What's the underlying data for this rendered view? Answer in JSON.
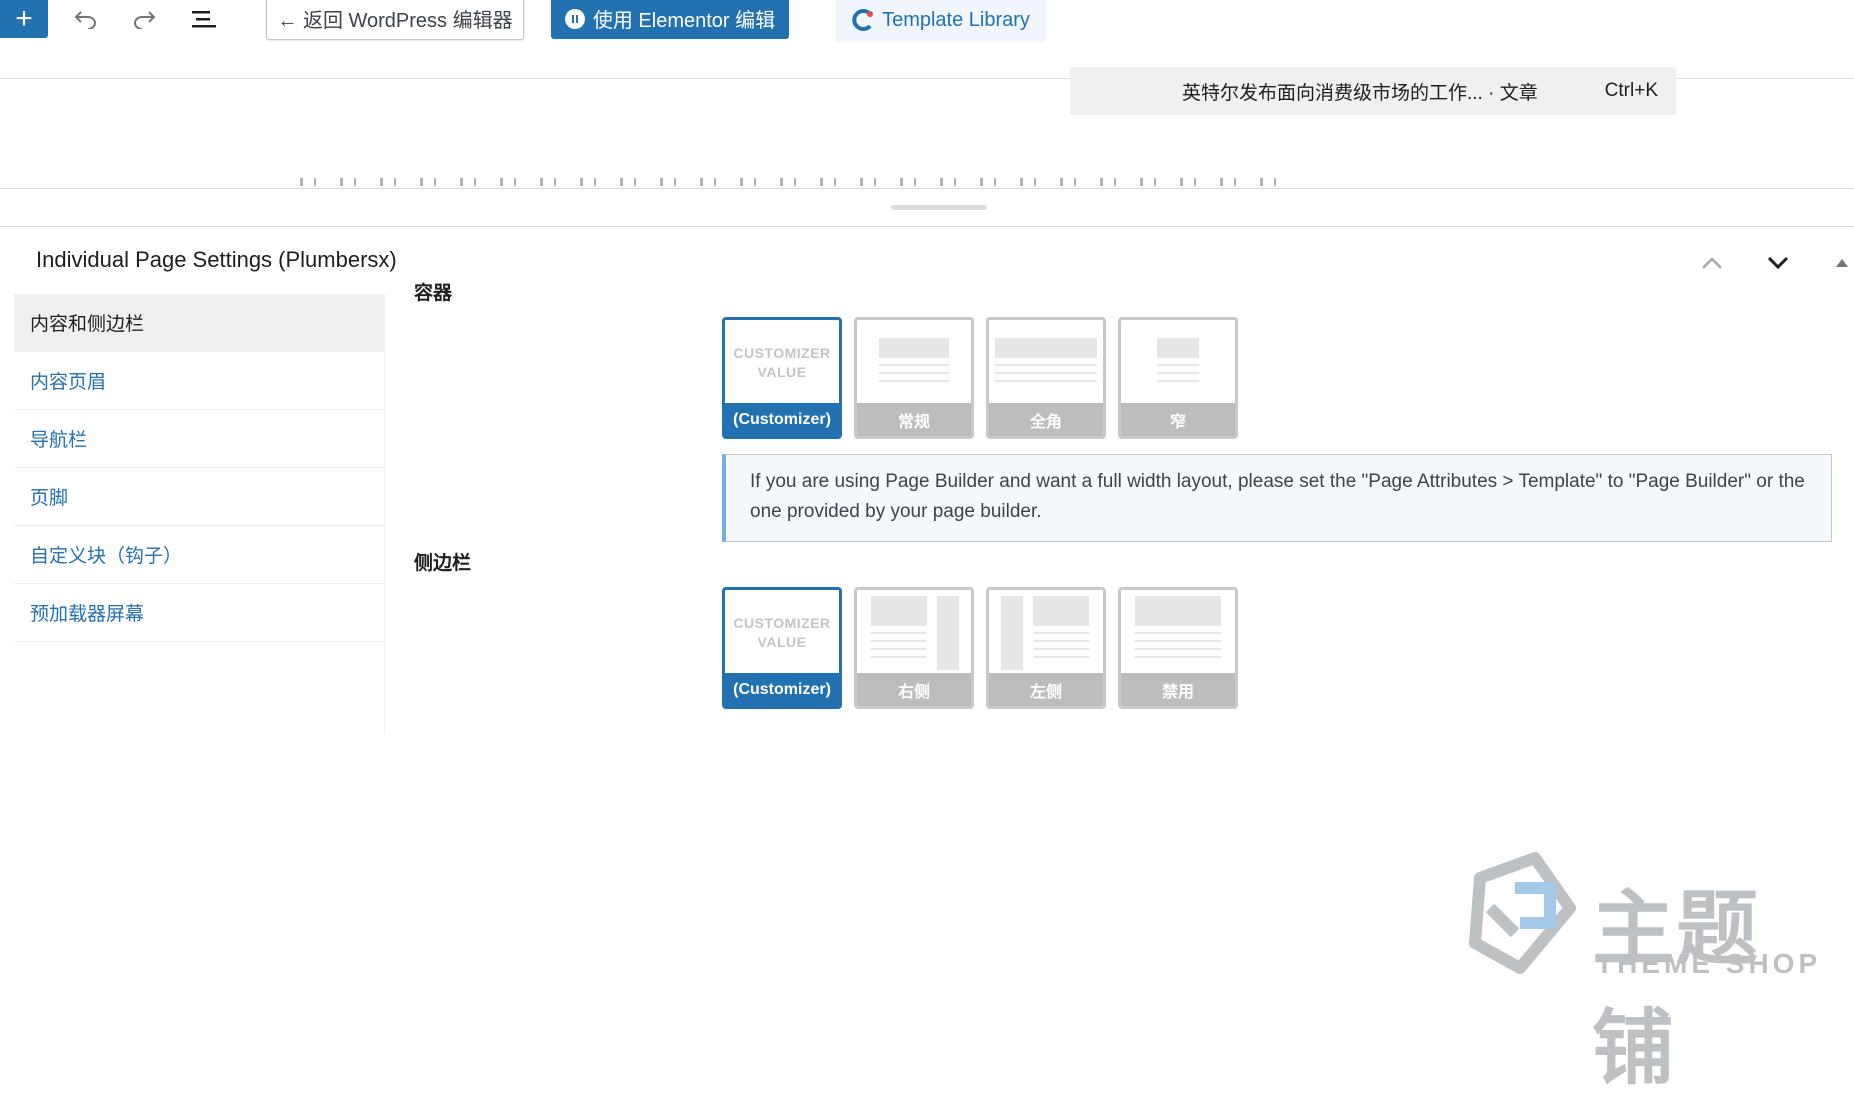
{
  "toolbar": {
    "add_label": "+",
    "back_label": "← 返回 WordPress 编辑器",
    "elementor_label": "使用 Elementor 编辑",
    "template_label": "Template Library"
  },
  "command_bar": {
    "title": "英特尔发布面向消费级市场的工作... · 文章",
    "shortcut": "Ctrl+K"
  },
  "meta_box": {
    "title": "Individual Page Settings (Plumbersx)",
    "tabs": [
      {
        "label": "内容和侧边栏",
        "active": true
      },
      {
        "label": "内容页眉"
      },
      {
        "label": "导航栏"
      },
      {
        "label": "页脚"
      },
      {
        "label": "自定义块（钩子）"
      },
      {
        "label": "预加载器屏幕"
      }
    ],
    "container": {
      "label": "容器",
      "options": [
        {
          "caption": "(Customizer)",
          "preview_text": "CUSTOMIZER VALUE",
          "selected": true
        },
        {
          "caption": "常规"
        },
        {
          "caption": "全角"
        },
        {
          "caption": "窄"
        }
      ],
      "notice": "If you are using Page Builder and want a full width layout, please set the \"Page Attributes > Template\" to \"Page Builder\" or the one provided by your page builder."
    },
    "sidebar": {
      "label": "侧边栏",
      "options": [
        {
          "caption": "(Customizer)",
          "preview_text": "CUSTOMIZER VALUE",
          "selected": true
        },
        {
          "caption": "右侧"
        },
        {
          "caption": "左侧"
        },
        {
          "caption": "禁用"
        }
      ]
    }
  },
  "watermark": {
    "cn": "主题铺",
    "en": "THEME SHOP"
  },
  "colors": {
    "accent": "#2271b1",
    "notice_border": "#72aee6",
    "option_gray": "#bdbdbd"
  }
}
